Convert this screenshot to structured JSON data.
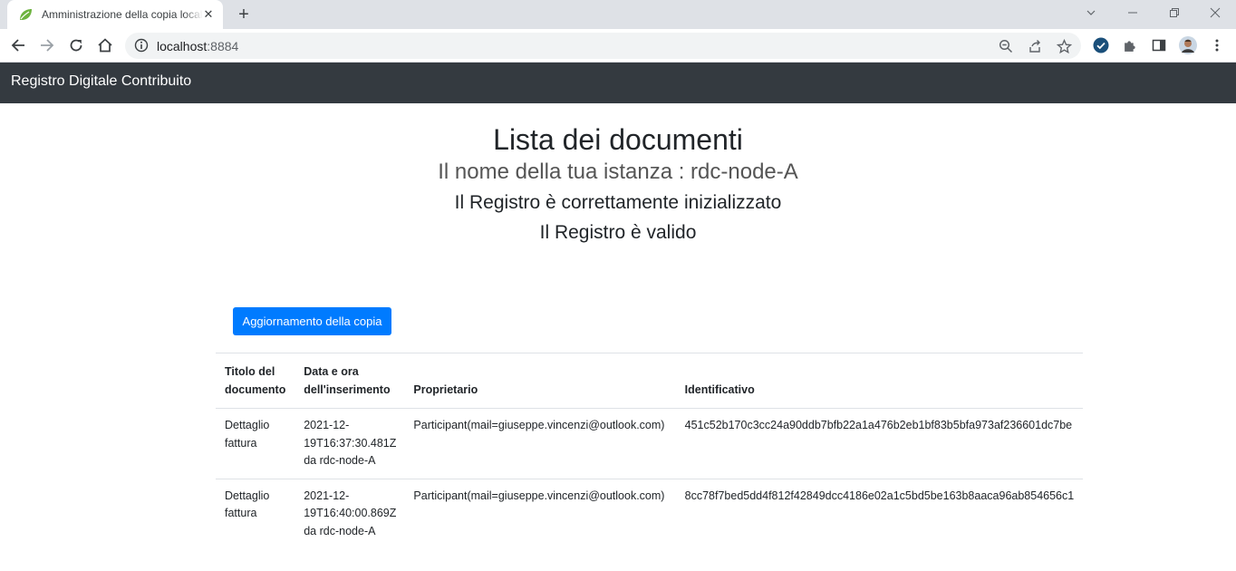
{
  "browser": {
    "tab_title": "Amministrazione della copia locale",
    "url_host": "localhost",
    "url_port": ":8884"
  },
  "app": {
    "brand": "Registro Digitale Contribuito"
  },
  "main": {
    "title": "Lista dei documenti",
    "instance": "Il nome della tua istanza : rdc-node-A",
    "init_status": "Il Registro è correttamente inizializzato",
    "valid_status": "Il Registro è valido",
    "update_button": "Aggiornamento della copia"
  },
  "table": {
    "headers": {
      "title_line1": "Titolo del",
      "title_line2": "documento",
      "date_line1": "Data e ora",
      "date_line2": "dell'inserimento",
      "owner": "Proprietario",
      "id": "Identificativo"
    },
    "rows": [
      {
        "title_line1": "Dettaglio",
        "title_line2": "fattura",
        "date_line1": "2021-12-",
        "date_line2": "19T16:37:30.481Z",
        "date_line3": "da rdc-node-A",
        "owner": "Participant(mail=giuseppe.vincenzi@outlook.com)",
        "id": "451c52b170c3cc24a90ddb7bfb22a1a476b2eb1bf83b5bfa973af236601dc7be"
      },
      {
        "title_line1": "Dettaglio",
        "title_line2": "fattura",
        "date_line1": "2021-12-",
        "date_line2": "19T16:40:00.869Z",
        "date_line3": "da rdc-node-A",
        "owner": "Participant(mail=giuseppe.vincenzi@outlook.com)",
        "id": "8cc78f7bed5dd4f812f42849dcc4186e02a1c5bd5be163b8aaca96ab854656c1"
      }
    ]
  },
  "colors": {
    "navbar": "#343a40",
    "primary_button": "#007bff"
  }
}
